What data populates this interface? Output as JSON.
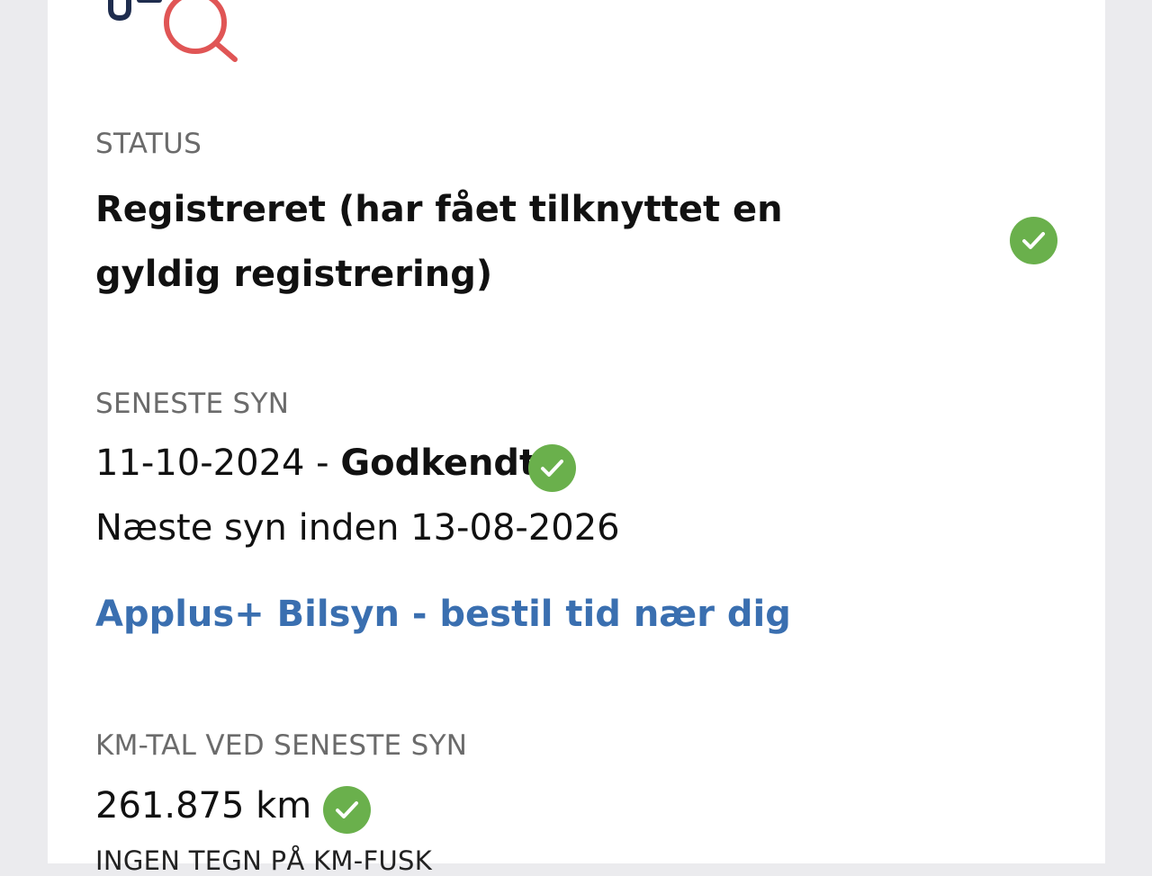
{
  "status": {
    "label": "STATUS",
    "value": "Registreret (har fået tilknyttet en gyldig registrering)"
  },
  "inspection": {
    "label": "SENESTE SYN",
    "date": "11-10-2024",
    "separator": " - ",
    "result": "Godkendt",
    "next_text": "Næste syn inden 13-08-2026",
    "booking_link": "Applus+ Bilsyn - bestil tid nær dig"
  },
  "mileage": {
    "label": "KM-TAL VED SENESTE SYN",
    "value": "261.875 km",
    "note": "INGEN TEGN PÅ KM-FUSK"
  },
  "colors": {
    "check_green": "#6ab04c",
    "link_blue": "#3a6fb0",
    "logo_navy": "#1f2d4e",
    "logo_red": "#e05555"
  },
  "icons": [
    "logo-magnifier-icon",
    "check-circle-icon"
  ]
}
